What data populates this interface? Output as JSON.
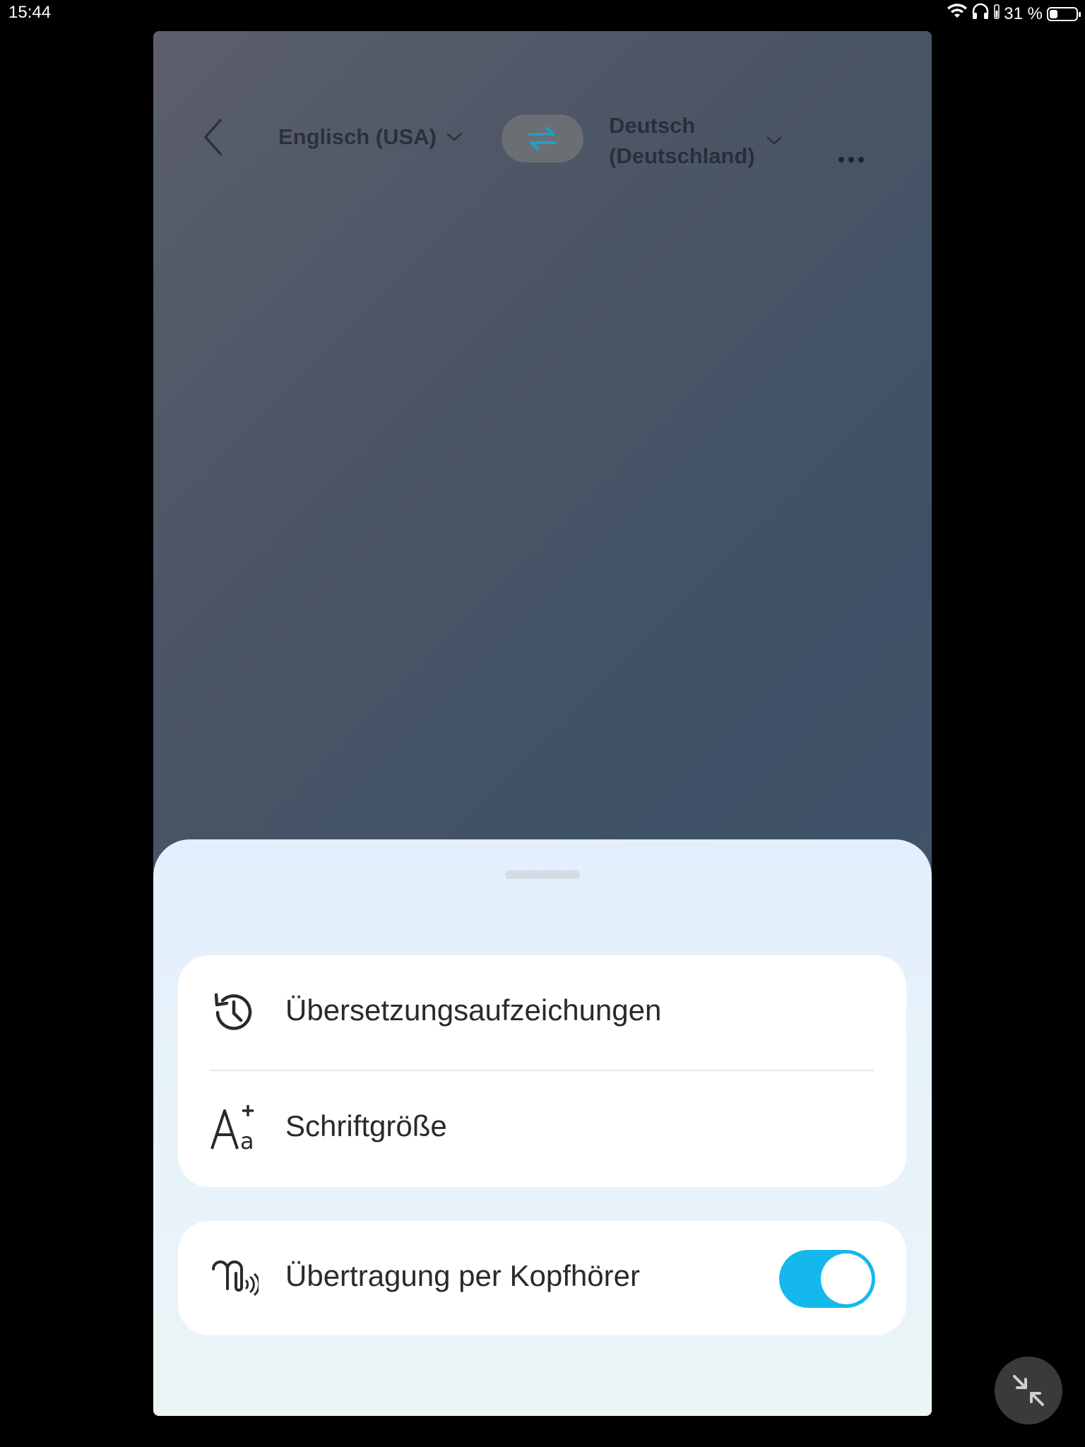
{
  "status_bar": {
    "time": "15:44",
    "battery_text": "31 %",
    "battery_level": 0.31,
    "icons": [
      "wifi-icon",
      "headphones-icon",
      "battery-icon"
    ]
  },
  "header": {
    "source_language": "Englisch (USA)",
    "target_language_line1": "Deutsch",
    "target_language_line2": "(Deutschland)"
  },
  "sheet": {
    "items": [
      {
        "label": "Übersetzungsaufzeichungen",
        "icon": "history-icon"
      },
      {
        "label": "Schriftgröße",
        "icon": "font-size-icon"
      }
    ],
    "headphone": {
      "label": "Übertragung per Kopfhörer",
      "icon": "earbuds-icon",
      "enabled": true
    }
  },
  "colors": {
    "accent": "#15b8ec",
    "sheet_bg": "#e6f1fa",
    "window_bg": "#4b5566"
  }
}
